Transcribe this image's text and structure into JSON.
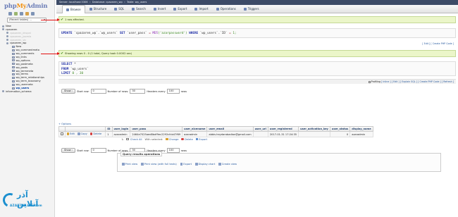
{
  "logo": {
    "php": "php",
    "my": "My",
    "admin": "Admin"
  },
  "nav": {
    "recent_select": "(Recent tables) ...",
    "tree": [
      {
        "label": "New",
        "level": 0,
        "style": "normal",
        "icon": "bullet"
      },
      {
        "label": "cpazaren",
        "level": 0,
        "style": "normal",
        "icon": "bullet"
      },
      {
        "label": "cpazaren_drupal",
        "level": 1,
        "style": "blur",
        "icon": "bullet"
      },
      {
        "label": "cpazaren_joomla",
        "level": 1,
        "style": "blur",
        "icon": "bullet"
      },
      {
        "label": "cpazaren_vb",
        "level": 1,
        "style": "blur",
        "icon": "bullet"
      },
      {
        "label": "cpazaren_wp",
        "level": 1,
        "style": "normal",
        "icon": "bullet"
      },
      {
        "label": "New",
        "level": 2,
        "style": "normal",
        "icon": "tbl"
      },
      {
        "label": "wp_commentmeta",
        "level": 2,
        "style": "normal",
        "icon": "tbl"
      },
      {
        "label": "wp_comments",
        "level": 2,
        "style": "normal",
        "icon": "tbl"
      },
      {
        "label": "wp_links",
        "level": 2,
        "style": "normal",
        "icon": "tbl"
      },
      {
        "label": "wp_options",
        "level": 2,
        "style": "normal",
        "icon": "tbl"
      },
      {
        "label": "wp_postmeta",
        "level": 2,
        "style": "normal",
        "icon": "tbl"
      },
      {
        "label": "wp_posts",
        "level": 2,
        "style": "normal",
        "icon": "tbl"
      },
      {
        "label": "wp_termmeta",
        "level": 2,
        "style": "normal",
        "icon": "tbl"
      },
      {
        "label": "wp_terms",
        "level": 2,
        "style": "normal",
        "icon": "tbl"
      },
      {
        "label": "wp_term_relationships",
        "level": 2,
        "style": "normal",
        "icon": "tbl"
      },
      {
        "label": "wp_term_taxonomy",
        "level": 2,
        "style": "normal",
        "icon": "tbl"
      },
      {
        "label": "wp_usermeta",
        "level": 2,
        "style": "normal",
        "icon": "tbl"
      },
      {
        "label": "wp_users",
        "level": 2,
        "style": "active",
        "icon": "tbl"
      },
      {
        "label": "information_schema",
        "level": 0,
        "style": "normal",
        "icon": "bullet"
      }
    ]
  },
  "breadcrumb": [
    "Server: localhost:3306",
    "Database: cpazaren_wp",
    "Table: wp_users"
  ],
  "tabs": [
    {
      "label": "Browse",
      "active": true
    },
    {
      "label": "Structure",
      "active": false
    },
    {
      "label": "SQL",
      "active": false
    },
    {
      "label": "Search",
      "active": false
    },
    {
      "label": "Insert",
      "active": false
    },
    {
      "label": "Export",
      "active": false
    },
    {
      "label": "Import",
      "active": false
    },
    {
      "label": "Operations",
      "active": false
    },
    {
      "label": "Triggers",
      "active": false
    }
  ],
  "msg1": "1 row affected.",
  "msg2": "Showing rows 0 - 0 (1 total, Query took 0.0002 sec)",
  "update_sql": {
    "kw_update": "UPDATE",
    "table": "`cpazaren_wp`.`wp_users`",
    "kw_set": "SET",
    "col": "`user_pass`",
    "eq": "=",
    "fn": "MD5",
    "val": "('azarpassword')",
    "kw_where": "WHERE",
    "where_col": "`wp_users`.`ID`",
    "where_val": "1;"
  },
  "update_links": "[ Edit ] [ Create PHP Code ]",
  "select_sql": {
    "kw_select": "SELECT",
    "star": "*",
    "kw_from": "FROM",
    "table": "`wp_users`",
    "kw_limit": "LIMIT",
    "limit_val": "0 , 30"
  },
  "profiling_label": "Profiling",
  "profiling_links": "[ Inline ] [ Edit ] [ Explain SQL ] [ Create PHP Code ] [ Refresh ]",
  "navrow": {
    "show_label": "Show :",
    "start_row_label": "Start row:",
    "start_row_value": "0",
    "num_rows_label": "Number of rows:",
    "num_rows_value": "30",
    "headers_every_label": "Headers every",
    "headers_every_value": "100",
    "rows_label": "rows"
  },
  "options_link": "+ Options",
  "result_table": {
    "columns": [
      "",
      "",
      "ID",
      "user_login",
      "user_pass",
      "user_nicename",
      "user_email",
      "user_url",
      "user_registered",
      "user_activation_key",
      "user_status",
      "display_name"
    ],
    "row": {
      "edit": "Edit",
      "copy": "Copy",
      "delete": "Delete",
      "ID": "1",
      "user_login": "azaradmin",
      "user_pass": "2464e7025aed8bdf9ec2292cfcb47f69",
      "user_nicename": "azaradmin",
      "user_email": "abbis.heydarabadian@gmail.com",
      "user_url": "",
      "user_registered": "2017-01-31 17:24:35",
      "user_activation_key": "",
      "user_status": "0",
      "display_name": "azaradmin"
    }
  },
  "bulk": {
    "check_all": "Check All",
    "with_selected": "With selected:",
    "change": "Change",
    "delete": "Delete",
    "export": "Export"
  },
  "qro": {
    "legend": "Query results operations",
    "print_view": "Print view",
    "print_view_full": "Print view (with full texts)",
    "export": "Export",
    "display_chart": "Display chart",
    "create_view": "Create view"
  },
  "watermark": {
    "fa": "آذر آنلاین",
    "en": "AZARONLINE.com"
  },
  "colors": {
    "top_bar": "#3d4b67",
    "success_bg": "#ebf6c9",
    "link": "#2a5ca0",
    "arrow_red": "#e21010",
    "watermark_blue": "#1b8fcf"
  }
}
